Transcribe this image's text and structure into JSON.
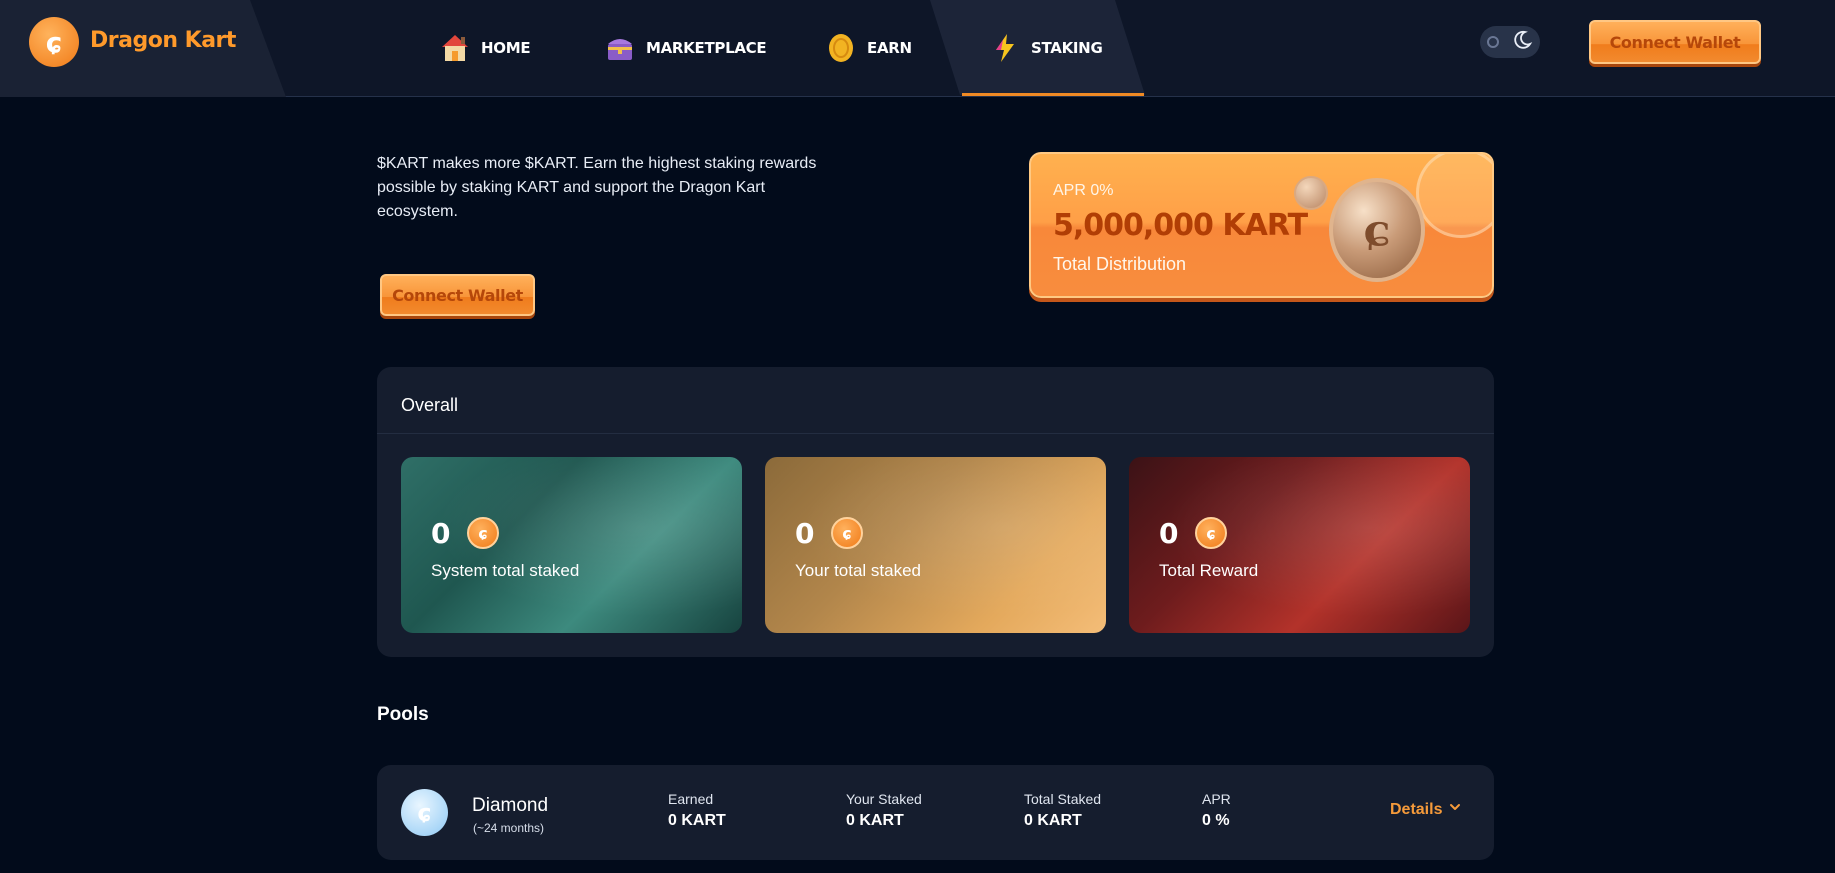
{
  "brand": {
    "name": "Dragon Kart",
    "logo_icon": "dragon-logo-icon"
  },
  "nav": {
    "items": [
      {
        "label": "HOME",
        "icon": "house-icon"
      },
      {
        "label": "MARKETPLACE",
        "icon": "treasure-chest-icon"
      },
      {
        "label": "EARN",
        "icon": "coin-icon"
      },
      {
        "label": "STAKING",
        "icon": "lightning-icon",
        "active": true
      }
    ]
  },
  "header": {
    "connect_label": "Connect Wallet",
    "theme_toggle": "dark"
  },
  "intro": {
    "text": "$KART makes more $KART. Earn the highest staking rewards possible by staking KART and support the Dragon Kart ecosystem.",
    "connect_label": "Connect Wallet"
  },
  "apr_card": {
    "apr_label": "APR 0%",
    "amount": "5,000,000 KART",
    "caption": "Total Distribution"
  },
  "overall": {
    "title": "Overall",
    "cards": [
      {
        "value": "0",
        "label": "System total staked",
        "theme": "teal"
      },
      {
        "value": "0",
        "label": "Your total staked",
        "theme": "gold"
      },
      {
        "value": "0",
        "label": "Total Reward",
        "theme": "red"
      }
    ]
  },
  "pools": {
    "title": "Pools",
    "rows": [
      {
        "name": "Diamond",
        "duration": "(~24 months)",
        "columns": [
          {
            "label": "Earned",
            "value": "0 KART"
          },
          {
            "label": "Your Staked",
            "value": "0 KART"
          },
          {
            "label": "Total Staked",
            "value": "0 KART"
          },
          {
            "label": "APR",
            "value": "0 %"
          }
        ],
        "details_label": "Details"
      }
    ]
  },
  "colors": {
    "accent": "#f59a3a",
    "background": "#020b1b",
    "panel": "#151d2e"
  }
}
